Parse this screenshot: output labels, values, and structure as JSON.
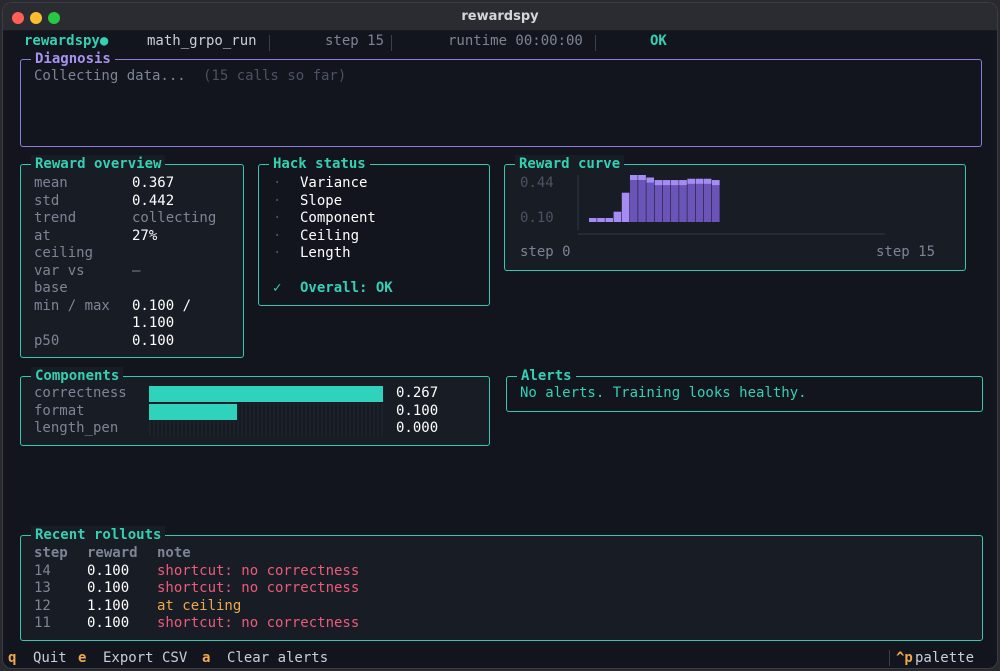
{
  "window": {
    "title": "rewardspy"
  },
  "header": {
    "app_name": "rewardspy●",
    "run_name": "math_grpo_run",
    "step": "step 15",
    "runtime": "runtime 00:00:00",
    "status": "OK"
  },
  "diagnosis": {
    "title": "Diagnosis",
    "message": "Collecting data...",
    "calls_note": "(15 calls so far)"
  },
  "reward_overview": {
    "title": "Reward overview",
    "rows": [
      {
        "label": "mean",
        "value": "0.367"
      },
      {
        "label": "std",
        "value": "0.442"
      },
      {
        "label": "trend",
        "value": "collecting"
      },
      {
        "label": "at",
        "label2": "ceiling",
        "value": "27%"
      },
      {
        "label": "var vs",
        "label2": "base",
        "value": "–"
      },
      {
        "label": "min / max",
        "value": "0.100 /",
        "value2": "1.100"
      },
      {
        "label": "p50",
        "value": "0.100"
      }
    ]
  },
  "hack_status": {
    "title": "Hack status",
    "items": [
      {
        "bullet": "·",
        "label": "Variance"
      },
      {
        "bullet": "·",
        "label": "Slope"
      },
      {
        "bullet": "·",
        "label": "Component"
      },
      {
        "bullet": "·",
        "label": "Ceiling"
      },
      {
        "bullet": "·",
        "label": "Length"
      }
    ],
    "overall_mark": "✓",
    "overall": "Overall: OK"
  },
  "reward_curve": {
    "title": "Reward curve",
    "y_top": "0.44",
    "y_bottom": "0.10",
    "x_start": "step 0",
    "x_end": "step 15"
  },
  "chart_data": {
    "type": "bar",
    "title": "Reward curve",
    "x": [
      0,
      1,
      2,
      3,
      4,
      5,
      6,
      7,
      8,
      9,
      10,
      11,
      12,
      13,
      14,
      15
    ],
    "values": [
      0.1,
      0.1,
      0.1,
      0.15,
      0.3,
      0.45,
      0.45,
      0.42,
      0.4,
      0.4,
      0.4,
      0.4,
      0.41,
      0.41,
      0.41,
      0.4
    ],
    "ylim": [
      0.1,
      0.44
    ],
    "y_tick_labels": [
      "0.44",
      "0.10"
    ],
    "x_tick_labels": [
      "step 0",
      "step 15"
    ],
    "color": "#a48cf4"
  },
  "components": {
    "title": "Components",
    "rows": [
      {
        "label": "correctness",
        "value": "0.267",
        "fraction": 1.0
      },
      {
        "label": "format",
        "value": "0.100",
        "fraction": 0.375
      },
      {
        "label": "length_pen",
        "value": "0.000",
        "fraction": 0.0
      }
    ]
  },
  "alerts": {
    "title": "Alerts",
    "message": "No alerts. Training looks healthy."
  },
  "rollouts": {
    "title": "Recent rollouts",
    "headers": {
      "step": "step",
      "reward": "reward",
      "note": "note"
    },
    "rows": [
      {
        "step": "14",
        "reward": "0.100",
        "note": "shortcut: no correctness",
        "tone": "red"
      },
      {
        "step": "13",
        "reward": "0.100",
        "note": "shortcut: no correctness",
        "tone": "red"
      },
      {
        "step": "12",
        "reward": "1.100",
        "note": "at ceiling",
        "tone": "orange"
      },
      {
        "step": "11",
        "reward": "0.100",
        "note": "shortcut: no correctness",
        "tone": "red"
      }
    ]
  },
  "footer": {
    "quit_key": "q",
    "quit_label": "Quit",
    "export_key": "e",
    "export_label": "Export CSV",
    "clear_key": "a",
    "clear_label": "Clear alerts",
    "palette_key": "^p",
    "palette_label": "palette"
  },
  "colors": {
    "accent": "#35d0b4",
    "violet": "#a892f0",
    "error": "#ee5a7a",
    "warning": "#f0a84a",
    "background": "#12151e"
  }
}
